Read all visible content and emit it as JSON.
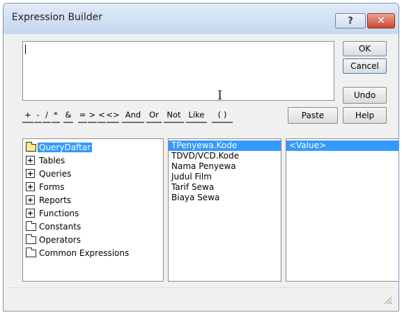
{
  "window": {
    "title": "Expression Builder",
    "help_glyph": "?",
    "close_glyph": "✕"
  },
  "expression": {
    "value": ""
  },
  "buttons": {
    "ok": "OK",
    "cancel": "Cancel",
    "undo": "Undo",
    "paste": "Paste",
    "help": "Help"
  },
  "operators": [
    "+",
    "-",
    "/",
    "*",
    "&",
    "=",
    ">",
    "<",
    "<>",
    "And",
    "Or",
    "Not",
    "Like",
    "( )"
  ],
  "tree": {
    "items": [
      {
        "label": "QueryDaftar",
        "icon": "folder-open-icon",
        "selected": true
      },
      {
        "label": "Tables",
        "icon": "expand-plus-icon"
      },
      {
        "label": "Queries",
        "icon": "expand-plus-icon"
      },
      {
        "label": "Forms",
        "icon": "expand-plus-icon"
      },
      {
        "label": "Reports",
        "icon": "expand-plus-icon"
      },
      {
        "label": "Functions",
        "icon": "expand-plus-icon"
      },
      {
        "label": "Constants",
        "icon": "folder-icon"
      },
      {
        "label": "Operators",
        "icon": "folder-icon"
      },
      {
        "label": "Common Expressions",
        "icon": "folder-icon"
      }
    ]
  },
  "fields": {
    "items": [
      "TPenyewa.Kode",
      "TDVD/VCD.Kode",
      "Nama Penyewa",
      "Judul Film",
      "Tarif Sewa",
      "Biaya Sewa"
    ],
    "selected_index": 0
  },
  "values": {
    "items": [
      "<Value>"
    ],
    "selected_index": 0
  },
  "colors": {
    "selection": "#3399ff",
    "titlebar": "#c6d7ee",
    "close_button": "#c9442c"
  }
}
